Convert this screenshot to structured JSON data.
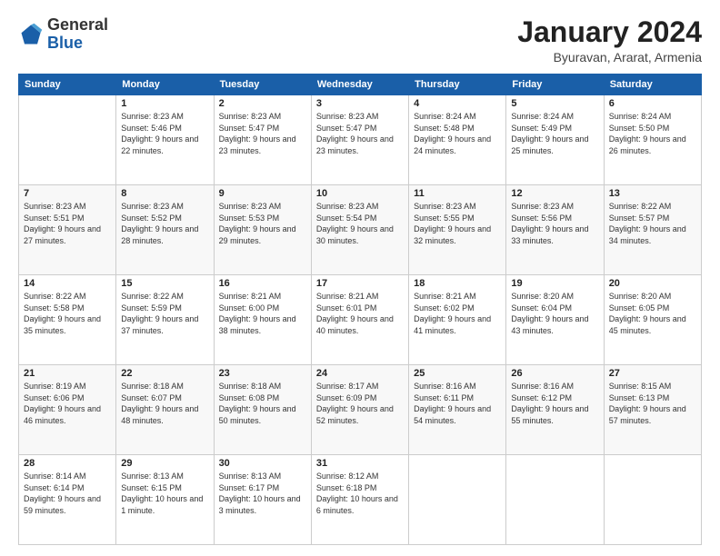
{
  "header": {
    "logo": {
      "general": "General",
      "blue": "Blue"
    },
    "title": "January 2024",
    "location": "Byuravan, Ararat, Armenia"
  },
  "weekdays": [
    "Sunday",
    "Monday",
    "Tuesday",
    "Wednesday",
    "Thursday",
    "Friday",
    "Saturday"
  ],
  "weeks": [
    [
      {
        "day": "",
        "sunrise": "",
        "sunset": "",
        "daylight": ""
      },
      {
        "day": "1",
        "sunrise": "Sunrise: 8:23 AM",
        "sunset": "Sunset: 5:46 PM",
        "daylight": "Daylight: 9 hours and 22 minutes."
      },
      {
        "day": "2",
        "sunrise": "Sunrise: 8:23 AM",
        "sunset": "Sunset: 5:47 PM",
        "daylight": "Daylight: 9 hours and 23 minutes."
      },
      {
        "day": "3",
        "sunrise": "Sunrise: 8:23 AM",
        "sunset": "Sunset: 5:47 PM",
        "daylight": "Daylight: 9 hours and 23 minutes."
      },
      {
        "day": "4",
        "sunrise": "Sunrise: 8:24 AM",
        "sunset": "Sunset: 5:48 PM",
        "daylight": "Daylight: 9 hours and 24 minutes."
      },
      {
        "day": "5",
        "sunrise": "Sunrise: 8:24 AM",
        "sunset": "Sunset: 5:49 PM",
        "daylight": "Daylight: 9 hours and 25 minutes."
      },
      {
        "day": "6",
        "sunrise": "Sunrise: 8:24 AM",
        "sunset": "Sunset: 5:50 PM",
        "daylight": "Daylight: 9 hours and 26 minutes."
      }
    ],
    [
      {
        "day": "7",
        "sunrise": "Sunrise: 8:23 AM",
        "sunset": "Sunset: 5:51 PM",
        "daylight": "Daylight: 9 hours and 27 minutes."
      },
      {
        "day": "8",
        "sunrise": "Sunrise: 8:23 AM",
        "sunset": "Sunset: 5:52 PM",
        "daylight": "Daylight: 9 hours and 28 minutes."
      },
      {
        "day": "9",
        "sunrise": "Sunrise: 8:23 AM",
        "sunset": "Sunset: 5:53 PM",
        "daylight": "Daylight: 9 hours and 29 minutes."
      },
      {
        "day": "10",
        "sunrise": "Sunrise: 8:23 AM",
        "sunset": "Sunset: 5:54 PM",
        "daylight": "Daylight: 9 hours and 30 minutes."
      },
      {
        "day": "11",
        "sunrise": "Sunrise: 8:23 AM",
        "sunset": "Sunset: 5:55 PM",
        "daylight": "Daylight: 9 hours and 32 minutes."
      },
      {
        "day": "12",
        "sunrise": "Sunrise: 8:23 AM",
        "sunset": "Sunset: 5:56 PM",
        "daylight": "Daylight: 9 hours and 33 minutes."
      },
      {
        "day": "13",
        "sunrise": "Sunrise: 8:22 AM",
        "sunset": "Sunset: 5:57 PM",
        "daylight": "Daylight: 9 hours and 34 minutes."
      }
    ],
    [
      {
        "day": "14",
        "sunrise": "Sunrise: 8:22 AM",
        "sunset": "Sunset: 5:58 PM",
        "daylight": "Daylight: 9 hours and 35 minutes."
      },
      {
        "day": "15",
        "sunrise": "Sunrise: 8:22 AM",
        "sunset": "Sunset: 5:59 PM",
        "daylight": "Daylight: 9 hours and 37 minutes."
      },
      {
        "day": "16",
        "sunrise": "Sunrise: 8:21 AM",
        "sunset": "Sunset: 6:00 PM",
        "daylight": "Daylight: 9 hours and 38 minutes."
      },
      {
        "day": "17",
        "sunrise": "Sunrise: 8:21 AM",
        "sunset": "Sunset: 6:01 PM",
        "daylight": "Daylight: 9 hours and 40 minutes."
      },
      {
        "day": "18",
        "sunrise": "Sunrise: 8:21 AM",
        "sunset": "Sunset: 6:02 PM",
        "daylight": "Daylight: 9 hours and 41 minutes."
      },
      {
        "day": "19",
        "sunrise": "Sunrise: 8:20 AM",
        "sunset": "Sunset: 6:04 PM",
        "daylight": "Daylight: 9 hours and 43 minutes."
      },
      {
        "day": "20",
        "sunrise": "Sunrise: 8:20 AM",
        "sunset": "Sunset: 6:05 PM",
        "daylight": "Daylight: 9 hours and 45 minutes."
      }
    ],
    [
      {
        "day": "21",
        "sunrise": "Sunrise: 8:19 AM",
        "sunset": "Sunset: 6:06 PM",
        "daylight": "Daylight: 9 hours and 46 minutes."
      },
      {
        "day": "22",
        "sunrise": "Sunrise: 8:18 AM",
        "sunset": "Sunset: 6:07 PM",
        "daylight": "Daylight: 9 hours and 48 minutes."
      },
      {
        "day": "23",
        "sunrise": "Sunrise: 8:18 AM",
        "sunset": "Sunset: 6:08 PM",
        "daylight": "Daylight: 9 hours and 50 minutes."
      },
      {
        "day": "24",
        "sunrise": "Sunrise: 8:17 AM",
        "sunset": "Sunset: 6:09 PM",
        "daylight": "Daylight: 9 hours and 52 minutes."
      },
      {
        "day": "25",
        "sunrise": "Sunrise: 8:16 AM",
        "sunset": "Sunset: 6:11 PM",
        "daylight": "Daylight: 9 hours and 54 minutes."
      },
      {
        "day": "26",
        "sunrise": "Sunrise: 8:16 AM",
        "sunset": "Sunset: 6:12 PM",
        "daylight": "Daylight: 9 hours and 55 minutes."
      },
      {
        "day": "27",
        "sunrise": "Sunrise: 8:15 AM",
        "sunset": "Sunset: 6:13 PM",
        "daylight": "Daylight: 9 hours and 57 minutes."
      }
    ],
    [
      {
        "day": "28",
        "sunrise": "Sunrise: 8:14 AM",
        "sunset": "Sunset: 6:14 PM",
        "daylight": "Daylight: 9 hours and 59 minutes."
      },
      {
        "day": "29",
        "sunrise": "Sunrise: 8:13 AM",
        "sunset": "Sunset: 6:15 PM",
        "daylight": "Daylight: 10 hours and 1 minute."
      },
      {
        "day": "30",
        "sunrise": "Sunrise: 8:13 AM",
        "sunset": "Sunset: 6:17 PM",
        "daylight": "Daylight: 10 hours and 3 minutes."
      },
      {
        "day": "31",
        "sunrise": "Sunrise: 8:12 AM",
        "sunset": "Sunset: 6:18 PM",
        "daylight": "Daylight: 10 hours and 6 minutes."
      },
      {
        "day": "",
        "sunrise": "",
        "sunset": "",
        "daylight": ""
      },
      {
        "day": "",
        "sunrise": "",
        "sunset": "",
        "daylight": ""
      },
      {
        "day": "",
        "sunrise": "",
        "sunset": "",
        "daylight": ""
      }
    ]
  ]
}
